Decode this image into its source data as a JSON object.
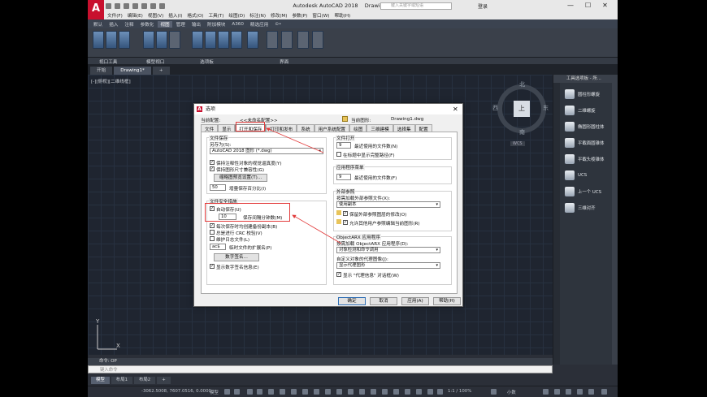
{
  "window": {
    "app_title": "Autodesk AutoCAD 2018",
    "doc_title": "Drawing1.dwg",
    "search_placeholder": "键入关键字或短语",
    "signin": "登录",
    "logo": "A",
    "controls": [
      "—",
      "☐",
      "✕"
    ]
  },
  "menubar": [
    "文件(F)",
    "编辑(E)",
    "视图(V)",
    "插入(I)",
    "格式(O)",
    "工具(T)",
    "绘图(D)",
    "标注(N)",
    "修改(M)",
    "参数(P)",
    "窗口(W)",
    "帮助(H)"
  ],
  "ribbon": {
    "tabs": [
      "默认",
      "插入",
      "注释",
      "参数化",
      "视图",
      "管理",
      "输出",
      "附加模块",
      "A360",
      "精选应用",
      "⊙•"
    ],
    "active_tab": "视图",
    "panels": [
      "视口工具",
      "模型视口",
      "选项板",
      "界面"
    ]
  },
  "doc_tabs": [
    "开始",
    "Drawing1*",
    "+"
  ],
  "canvas": {
    "view_label": "[-][俯视][二维线框]",
    "viewcube": {
      "north": "北",
      "south": "南",
      "west": "西",
      "east": "东",
      "face": "上"
    },
    "wcs": "WCS"
  },
  "tool_palette": {
    "header": "工具选项板 - 所...",
    "items": [
      "圆柱形螺旋",
      "二维螺旋",
      "椭圆形圆柱体",
      "平截面圆锥体",
      "平截头棱锥体",
      "UCS",
      "上一个 UCS",
      "三维对齐"
    ]
  },
  "command": {
    "history": "命令: OP",
    "placeholder": "键入命令"
  },
  "layout_tabs": [
    "模型",
    "布局1",
    "布局2",
    "+"
  ],
  "status": {
    "coords": "-3062.5008, 7607.0516, 0.0000",
    "mode": "模型",
    "zoom": "1:1 / 100%",
    "unit": "小数"
  },
  "dialog": {
    "title": "选项",
    "current_profile_label": "当前配置:",
    "current_profile": "<<未命名配置>>",
    "current_drawing_label": "当前图形:",
    "current_drawing": "Drawing1.dwg",
    "tabs": [
      "文件",
      "显示",
      "打开和保存",
      "打印和发布",
      "系统",
      "用户系统配置",
      "绘图",
      "三维建模",
      "选择集",
      "配置"
    ],
    "active_tab": "打开和保存",
    "file_save": {
      "title": "文件保存",
      "save_as_label": "另存为(S):",
      "save_as_value": "AutoCAD 2018 图形 (*.dwg)",
      "maintain_visual_fidelity": "保持注释性对象的视觉逼真度(Y)",
      "maintain_drawing_size": "保持图形尺寸兼容性(G)",
      "thumbnail_button": "缩略图预览设置(T)...",
      "incremental_value": "50",
      "incremental_label": "增量保存百分比(I)"
    },
    "file_safety": {
      "title": "文件安全措施",
      "autosave_label": "自动保存(U)",
      "autosave_minutes": "10",
      "minutes_label": "保存间隔分钟数(M)",
      "backup_copy": "每次保存时均创建备份副本(B)",
      "crc": "总是进行 CRC 校验(V)",
      "log_file": "维护日志文件(L)",
      "temp_ext": "ac$",
      "temp_ext_label": "临时文件的扩展名(P)",
      "digital_sig_button": "数字签名...",
      "digital_sig_info": "显示数字签名信息(E)"
    },
    "file_open": {
      "title": "文件打开",
      "recent_count": "9",
      "recent_label": "最近使用的文件数(N)",
      "full_path": "在标题中显示完整路径(F)"
    },
    "app_menu": {
      "title": "应用程序菜单",
      "recent_count": "9",
      "recent_label": "最近使用的文件数(F)"
    },
    "xrefs": {
      "title": "外部参照",
      "demand_load_label": "按需加载外部参照文件(X):",
      "demand_load_value": "使用副本",
      "retain_changes": "保留外部参照图层的修改(O)",
      "allow_edit": "允许其他用户参照编辑当前图形(R)"
    },
    "objectarx": {
      "title": "ObjectARX 应用程序",
      "demand_load_label": "按需加载 ObjectARX 应用程序(D):",
      "demand_load_value": "对象检测和命令调用",
      "proxy_label": "自定义对象的代理图像(J):",
      "proxy_value": "显示代理图形",
      "proxy_info": "显示 \"代理信息\" 对话框(W)"
    },
    "buttons": {
      "ok": "确定",
      "cancel": "取消",
      "apply": "应用(A)",
      "help": "帮助(H)"
    }
  }
}
